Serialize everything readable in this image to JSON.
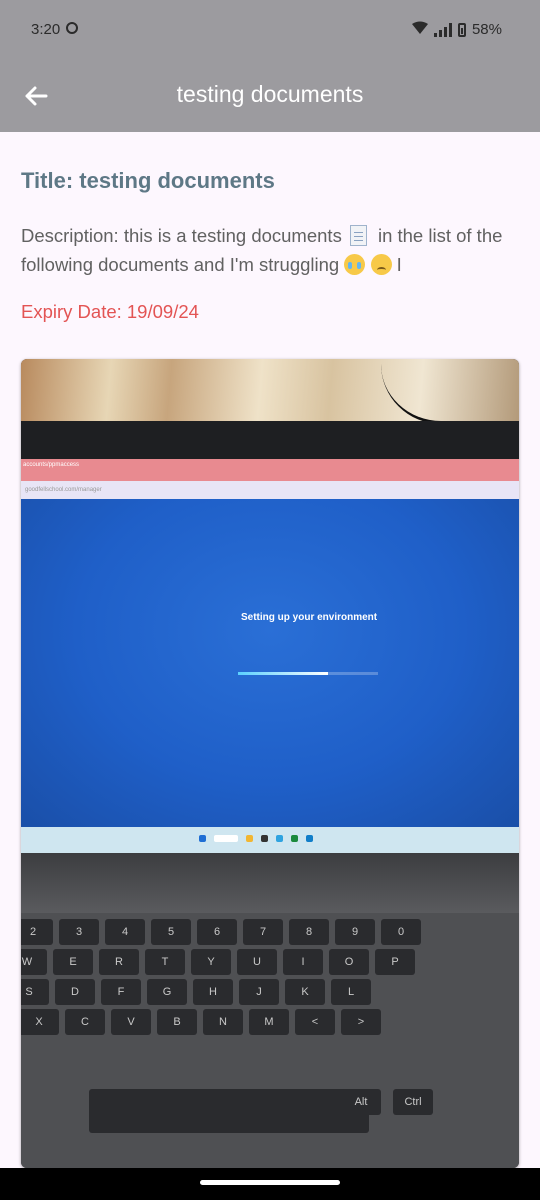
{
  "status_bar": {
    "time": "3:20",
    "battery": "58%"
  },
  "app_bar": {
    "title": "testing documents"
  },
  "document": {
    "title": "Title: testing documents",
    "description_part1": "Description: this is a testing documents",
    "description_part2": "in the list of the following documents and I'm struggling",
    "description_end": "I",
    "expiry": "Expiry Date: 19/09/24"
  },
  "photo": {
    "screen_text": "Setting up your environment",
    "progress": 0.64,
    "browser_tab": "accounts/ppmaccess",
    "browser_url": "goodfellschool.com/manager",
    "keys_row1": [
      "2",
      "3",
      "4",
      "5",
      "6",
      "7",
      "8",
      "9",
      "0"
    ],
    "keys_row2": [
      "W",
      "E",
      "R",
      "T",
      "Y",
      "U",
      "I",
      "O",
      "P"
    ],
    "keys_row3": [
      "S",
      "D",
      "F",
      "G",
      "H",
      "J",
      "K",
      "L"
    ],
    "keys_row4": [
      "X",
      "C",
      "V",
      "B",
      "N",
      "M",
      "<",
      ">"
    ],
    "key_alt": "Alt",
    "key_ctrl": "Ctrl"
  }
}
